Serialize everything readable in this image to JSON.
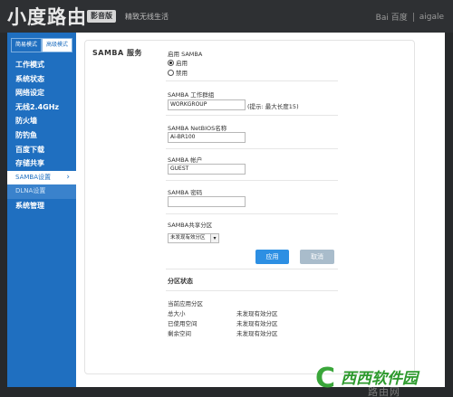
{
  "header": {
    "logo": "小度路由",
    "edition": "影音版",
    "slogan": "精致无线生活",
    "brand_baidu": "Bai 百度",
    "brand_aigale": "aigale"
  },
  "sidebar": {
    "mode_simple": "简易模式",
    "mode_advanced": "高级模式",
    "items": [
      {
        "label": "工作模式"
      },
      {
        "label": "系统状态"
      },
      {
        "label": "网络设定"
      },
      {
        "label": "无线2.4GHz"
      },
      {
        "label": "防火墙"
      },
      {
        "label": "防钓鱼"
      },
      {
        "label": "百度下载"
      },
      {
        "label": "存储共享"
      },
      {
        "label": "SAMBA设置"
      },
      {
        "label": "DLNA设置"
      },
      {
        "label": "系统管理"
      }
    ]
  },
  "main": {
    "section_title": "SAMBA 服务",
    "enable_label": "启用 SAMBA",
    "opt_enable": "启用",
    "opt_disable": "禁用",
    "workgroup_label": "SAMBA 工作群组",
    "workgroup_value": "WORKGROUP",
    "workgroup_hint": "(提示: 最大长度15)",
    "netbios_label": "SAMBA NetBIOS名称",
    "netbios_value": "Ai-BR100",
    "account_label": "SAMBA 帐户",
    "account_value": "GUEST",
    "password_label": "SAMBA 密码",
    "password_value": "",
    "share_label": "SAMBA共享分区",
    "share_selected": "未发现有效分区",
    "apply": "应用",
    "cancel": "取消",
    "partition_title": "分区状态",
    "current_partition": "当前应用分区",
    "rows": [
      {
        "label": "总大小",
        "value": "未发现有效分区"
      },
      {
        "label": "已使用空间",
        "value": "未发现有效分区"
      },
      {
        "label": "剩余空间",
        "value": "未发现有效分区"
      }
    ]
  },
  "watermark": {
    "brand": "西西软件园",
    "url": "路由网"
  },
  "colors": {
    "sidebar": "#1f6fc0",
    "primary_button": "#2d8fe3",
    "secondary_button": "#a9bccb",
    "header": "#2e3033"
  }
}
